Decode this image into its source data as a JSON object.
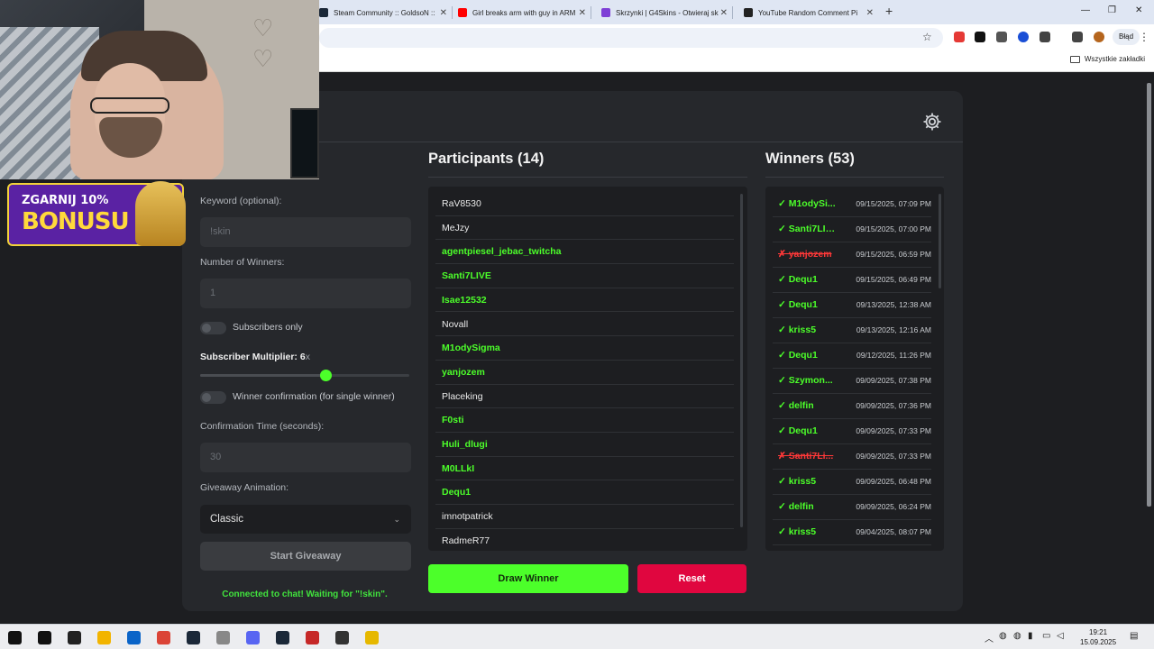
{
  "browser": {
    "tabs": [
      {
        "title": "Steam Community :: GoldsoN ::",
        "favicon_color": "#1b2838"
      },
      {
        "title": "Girl breaks arm with guy in ARM",
        "favicon_color": "#ff0000"
      },
      {
        "title": "Skrzynki | G4Skins - Otwieraj sk",
        "favicon_color": "#7e3fd6"
      },
      {
        "title": "YouTube Random Comment Pi",
        "favicon_color": "#222222"
      }
    ],
    "new_tab_symbol": "+",
    "window_controls": {
      "minimize": "—",
      "maximize": "❐",
      "close": "✕"
    },
    "profile_status": "Błąd",
    "bookmarks_all": "Wszystkie zakładki",
    "extension_colors": [
      "#e53935",
      "#111111",
      "#555555",
      "#1a4fd6",
      "#444444",
      "#444444",
      "#b5651d"
    ]
  },
  "settings": {
    "keyword_label": "Keyword (optional):",
    "keyword_placeholder": "!skin",
    "winners_label": "Number of Winners:",
    "winners_value": "1",
    "subscribers_only_label": "Subscribers only",
    "subscribers_only_on": false,
    "multiplier_label": "Subscriber Multiplier: 6",
    "multiplier_suffix": "x",
    "multiplier_value": 6,
    "multiplier_max": 10,
    "confirmation_label": "Winner confirmation (for single winner)",
    "confirmation_on": false,
    "confirm_time_label": "Confirmation Time (seconds):",
    "confirm_time_value": "30",
    "animation_label": "Giveaway Animation:",
    "animation_value": "Classic",
    "start_button": "Start Giveaway",
    "status": "Connected to chat! Waiting for \"!skin\"."
  },
  "participants": {
    "title": "Participants (14)",
    "items": [
      {
        "name": "RaV8530",
        "subscriber": false
      },
      {
        "name": "MeJzy",
        "subscriber": false
      },
      {
        "name": "agentpiesel_jebac_twitcha",
        "subscriber": true
      },
      {
        "name": "Santi7LIVE",
        "subscriber": true
      },
      {
        "name": "Isae12532",
        "subscriber": true
      },
      {
        "name": "Novall",
        "subscriber": false
      },
      {
        "name": "M1odySigma",
        "subscriber": true
      },
      {
        "name": "yanjozem",
        "subscriber": true
      },
      {
        "name": "Placeking",
        "subscriber": false
      },
      {
        "name": "F0sti",
        "subscriber": true
      },
      {
        "name": "Huli_dlugi",
        "subscriber": true
      },
      {
        "name": "M0LLkI",
        "subscriber": true
      },
      {
        "name": "Dequ1",
        "subscriber": true
      },
      {
        "name": "imnotpatrick",
        "subscriber": false
      },
      {
        "name": "RadmeR77",
        "subscriber": false
      }
    ],
    "draw_button": "Draw Winner",
    "reset_button": "Reset"
  },
  "winners": {
    "title": "Winners (53)",
    "items": [
      {
        "name": "✓ M1odySi...",
        "date": "09/15/2025, 07:09 PM",
        "rejected": false
      },
      {
        "name": "✓ Santi7LIVE",
        "date": "09/15/2025, 07:00 PM",
        "rejected": false
      },
      {
        "name": "✗ yanjozem",
        "date": "09/15/2025, 06:59 PM",
        "rejected": true
      },
      {
        "name": "✓ Dequ1",
        "date": "09/15/2025, 06:49 PM",
        "rejected": false
      },
      {
        "name": "✓ Dequ1",
        "date": "09/13/2025, 12:38 AM",
        "rejected": false
      },
      {
        "name": "✓ kriss5",
        "date": "09/13/2025, 12:16 AM",
        "rejected": false
      },
      {
        "name": "✓ Dequ1",
        "date": "09/12/2025, 11:26 PM",
        "rejected": false
      },
      {
        "name": "✓ Szymon...",
        "date": "09/09/2025, 07:38 PM",
        "rejected": false
      },
      {
        "name": "✓ delfin",
        "date": "09/09/2025, 07:36 PM",
        "rejected": false
      },
      {
        "name": "✓ Dequ1",
        "date": "09/09/2025, 07:33 PM",
        "rejected": false
      },
      {
        "name": "✗ Santi7Li...",
        "date": "09/09/2025, 07:33 PM",
        "rejected": true
      },
      {
        "name": "✓ kriss5",
        "date": "09/09/2025, 06:48 PM",
        "rejected": false
      },
      {
        "name": "✓ delfin",
        "date": "09/09/2025, 06:24 PM",
        "rejected": false
      },
      {
        "name": "✓ kriss5",
        "date": "09/04/2025, 08:07 PM",
        "rejected": false
      }
    ]
  },
  "overlay": {
    "banner_line1": "ZGARNIJ 10%",
    "banner_line2": "BONUSU"
  },
  "taskbar": {
    "time": "19:21",
    "date": "15.09.2025",
    "app_colors": [
      "#111111",
      "#111111",
      "#222222",
      "#f2b400",
      "#0a64c8",
      "#db4437",
      "#1b2838",
      "#888888",
      "#5865f2",
      "#1b2838",
      "#c62828",
      "#333333",
      "#e6b800"
    ]
  }
}
